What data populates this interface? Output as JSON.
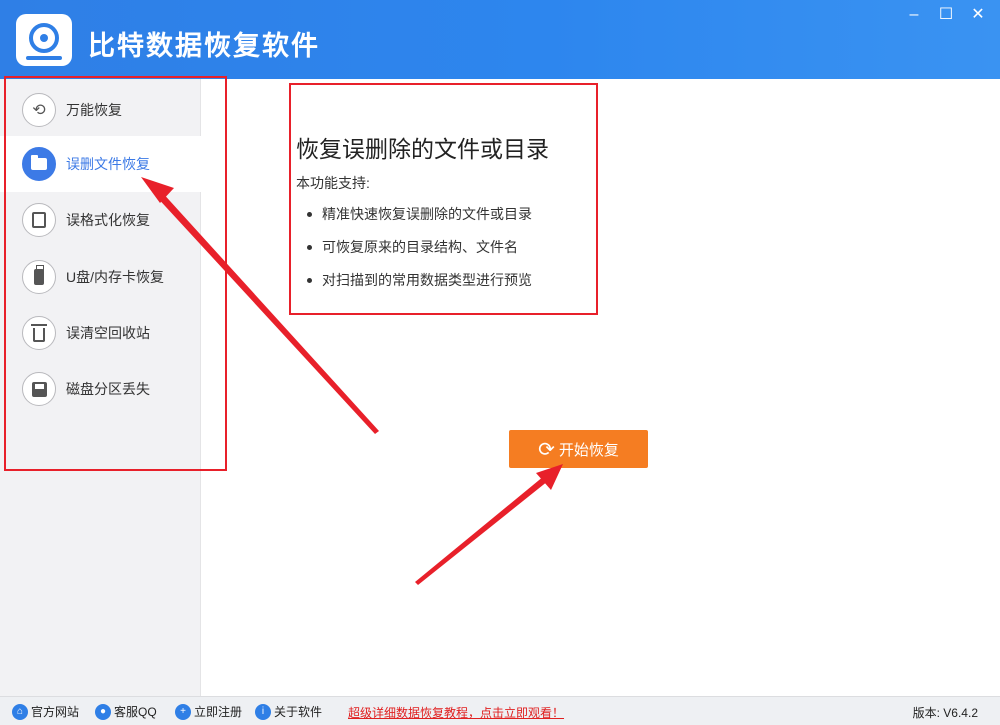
{
  "titlebar": {
    "app_title": "比特数据恢复软件",
    "minimize": "–",
    "maximize": "☐",
    "close": "✕",
    "logo_icon": "disk-recovery-logo-icon"
  },
  "sidebar": {
    "items": [
      {
        "label": "万能恢复",
        "icon": "undo-icon"
      },
      {
        "label": "误删文件恢复",
        "icon": "folder-icon"
      },
      {
        "label": "误格式化恢复",
        "icon": "format-icon"
      },
      {
        "label": "U盘/内存卡恢复",
        "icon": "usb-icon"
      },
      {
        "label": "误清空回收站",
        "icon": "trash-icon"
      },
      {
        "label": "磁盘分区丢失",
        "icon": "disk-icon"
      }
    ],
    "active_index": 1
  },
  "info": {
    "title": "恢复误删除的文件或目录",
    "subtitle": "本功能支持:",
    "bullets": [
      "精准快速恢复误删除的文件或目录",
      "可恢复原来的目录结构、文件名",
      "对扫描到的常用数据类型进行预览"
    ]
  },
  "start_button": {
    "label": "开始恢复",
    "icon": "refresh-icon"
  },
  "statusbar": {
    "official_site": "官方网站",
    "service_qq": "客服QQ",
    "register": "立即注册",
    "about": "关于软件",
    "promo": "超级详细数据恢复教程，点击立即观看！",
    "version": "版本: V6.4.2"
  },
  "colors": {
    "titlebar": "#2f7fe6",
    "accent": "#3c7ae6",
    "start_button": "#f57d22",
    "highlight": "#e8202a"
  }
}
